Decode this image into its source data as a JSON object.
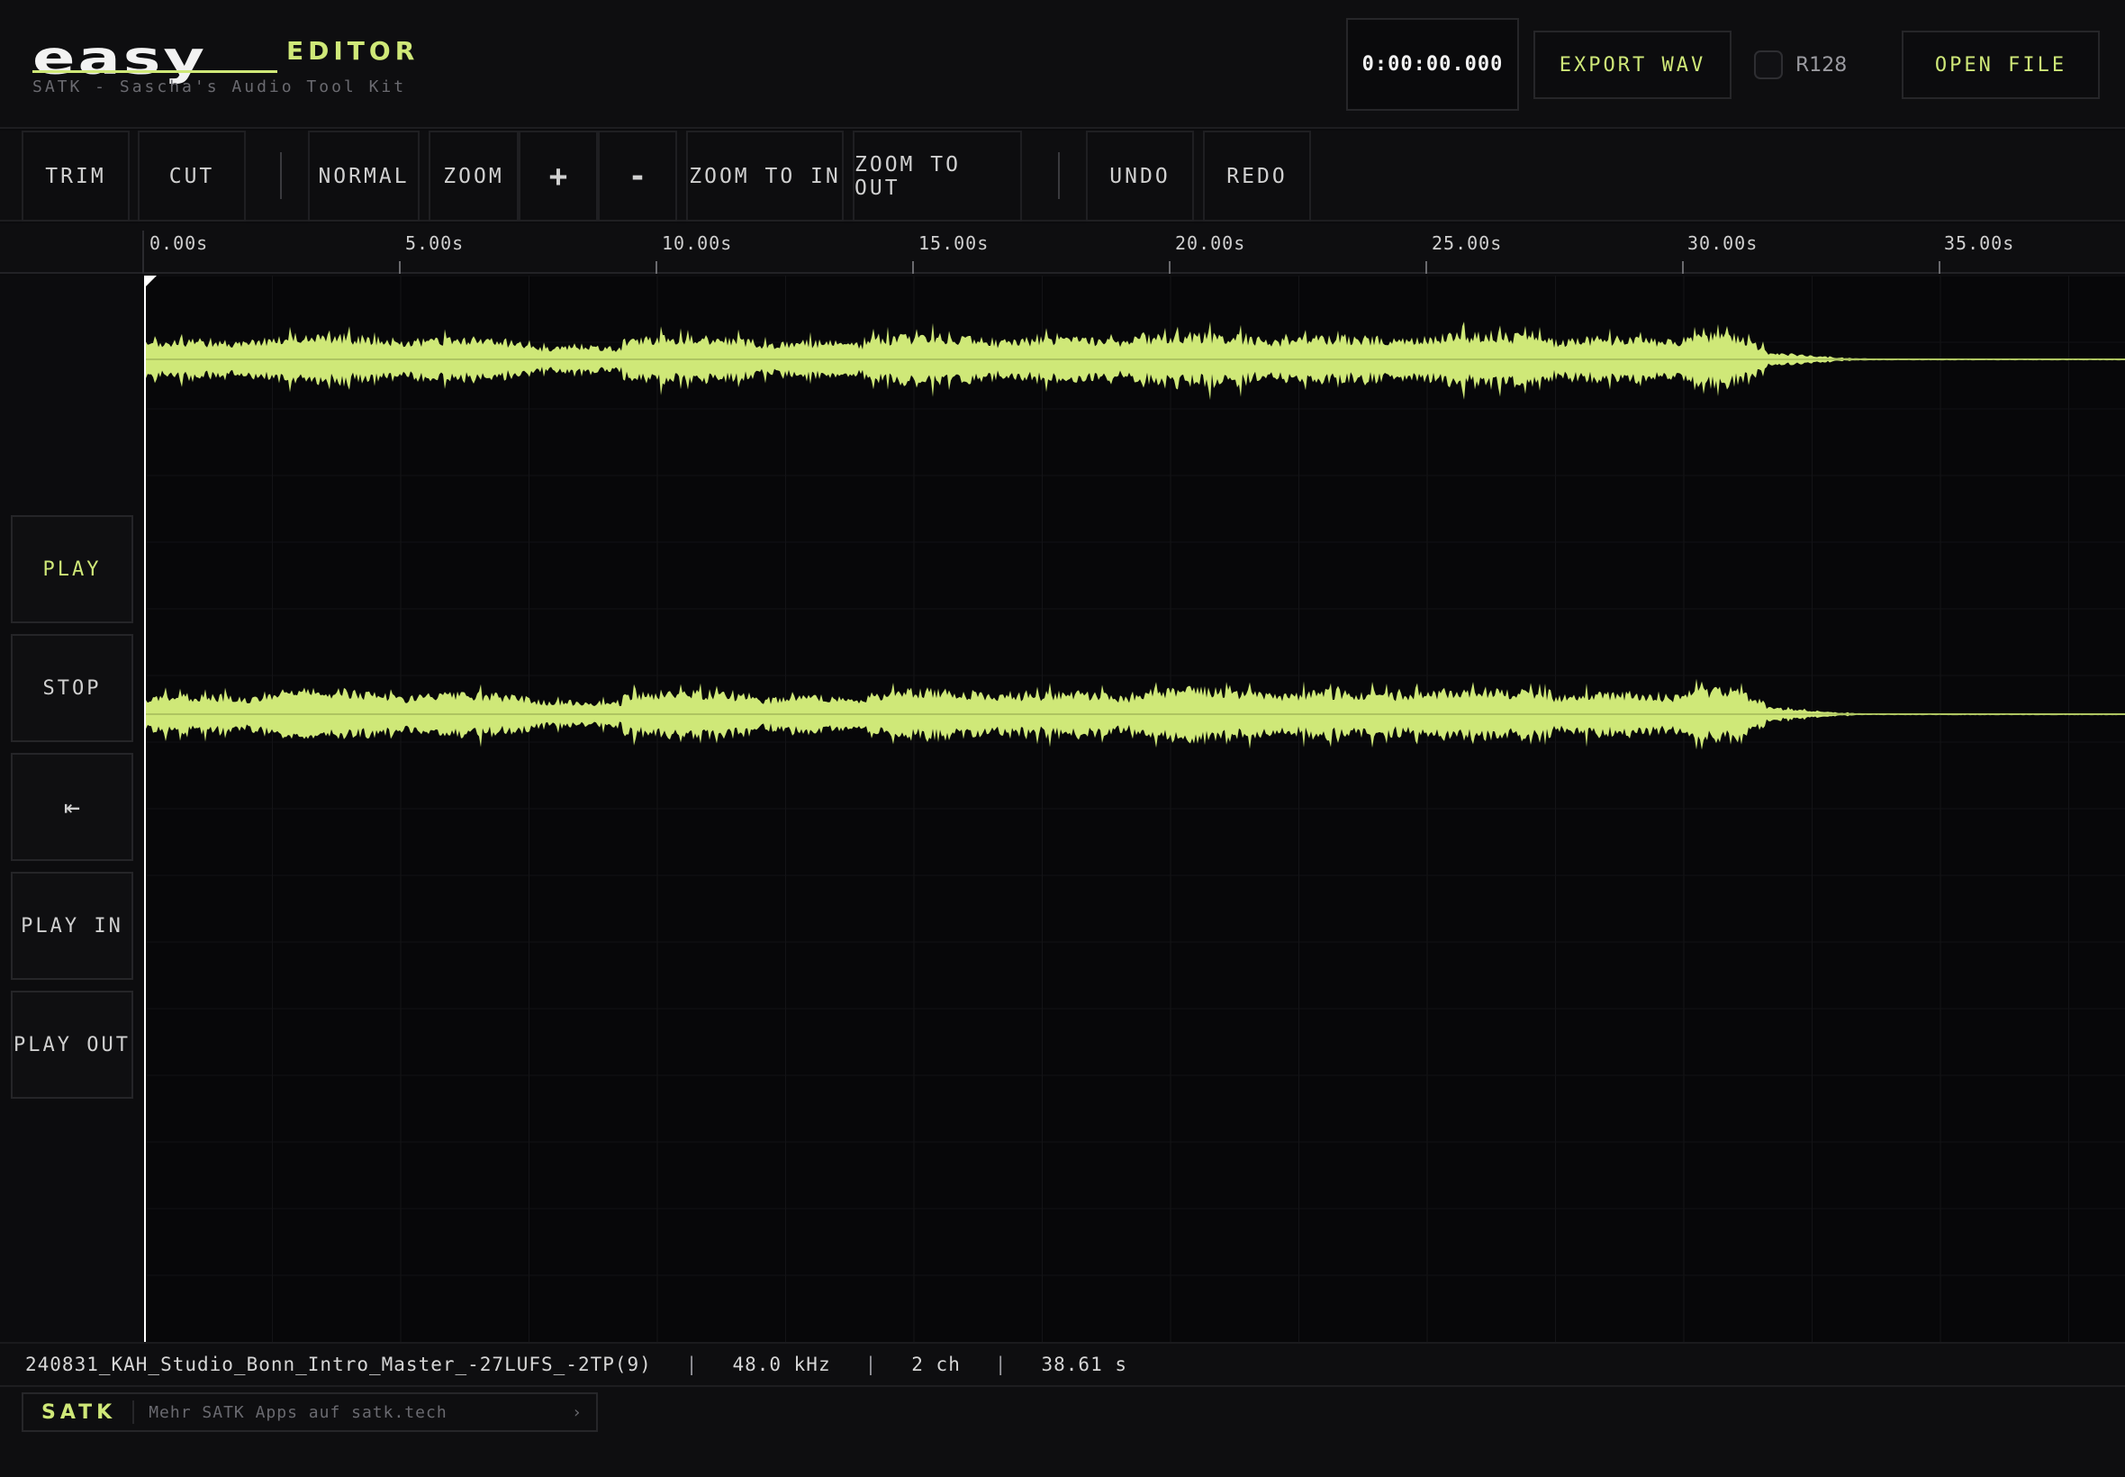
{
  "app": {
    "logo": "easy",
    "logo_suffix": "EDITOR",
    "subtitle": "SATK - Sascha's Audio Tool Kit"
  },
  "header": {
    "timecode": "0:00:00.000",
    "export_label": "EXPORT WAV",
    "r128_label": "R128",
    "r128_checked": false,
    "open_label": "OPEN FILE"
  },
  "toolbar": {
    "trim": "TRIM",
    "cut": "CUT",
    "normal": "NORMAL",
    "zoom": "ZOOM",
    "zoom_plus": "+",
    "zoom_minus": "-",
    "zoom_to_in": "ZOOM TO IN",
    "zoom_to_out": "ZOOM TO OUT",
    "undo": "UNDO",
    "redo": "REDO"
  },
  "ruler": {
    "ticks": [
      "0.00s",
      "5.00s",
      "10.00s",
      "15.00s",
      "20.00s",
      "25.00s",
      "30.00s",
      "35.00s"
    ]
  },
  "transport": {
    "play": "PLAY",
    "stop": "STOP",
    "to_start_icon": "⇤",
    "play_in": "PLAY IN",
    "play_out": "PLAY OUT"
  },
  "waveform": {
    "channels": 2,
    "color": "#cfe878",
    "duration_s": 38.61,
    "playhead_s": 0
  },
  "status": {
    "filename": "240831_KAH_Studio_Bonn_Intro_Master_-27LUFS_-2TP(9)",
    "sep": "|",
    "sample_rate": "48.0 kHz",
    "channels": "2 ch",
    "duration": "38.61 s"
  },
  "footer": {
    "brand": "SATK",
    "link_text": "Mehr SATK Apps auf satk.tech",
    "arrow": "›"
  },
  "colors": {
    "accent": "#cfe878",
    "background": "#0b0b0d"
  }
}
